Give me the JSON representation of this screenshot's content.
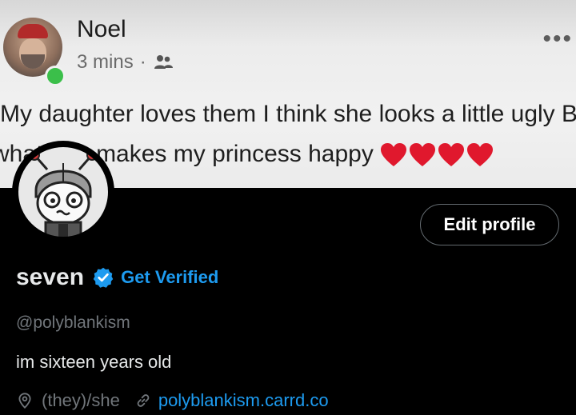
{
  "banner": {
    "post": {
      "author": "Noel",
      "time": "3 mins",
      "separator": "·",
      "privacy_icon": "friends-icon",
      "more_icon": "more-dots-icon",
      "more_glyph": "•••",
      "text_line1": "My daughter loves them I think she looks a little ugly But",
      "text_line2": "whatever makes my princess happy",
      "emoji": [
        "heart",
        "heart",
        "heart",
        "heart"
      ],
      "colors": {
        "heart": "#e0182d",
        "online": "#3bbf4a"
      }
    }
  },
  "profile": {
    "avatar_icon": "cartoon-robot-avatar",
    "edit_button_label": "Edit profile",
    "display_name": "seven",
    "verified_icon": "verified-badge-icon",
    "get_verified_label": "Get Verified",
    "handle": "@polyblankism",
    "bio": "im sixteen years old",
    "location_icon": "location-pin-icon",
    "pronouns": "(they)/she",
    "link_icon": "link-icon",
    "website": "polyblankism.carrd.co"
  },
  "colors": {
    "background": "#000000",
    "primary_text": "#e7e9ea",
    "secondary_text": "#71767b",
    "accent": "#1d9bf0"
  }
}
